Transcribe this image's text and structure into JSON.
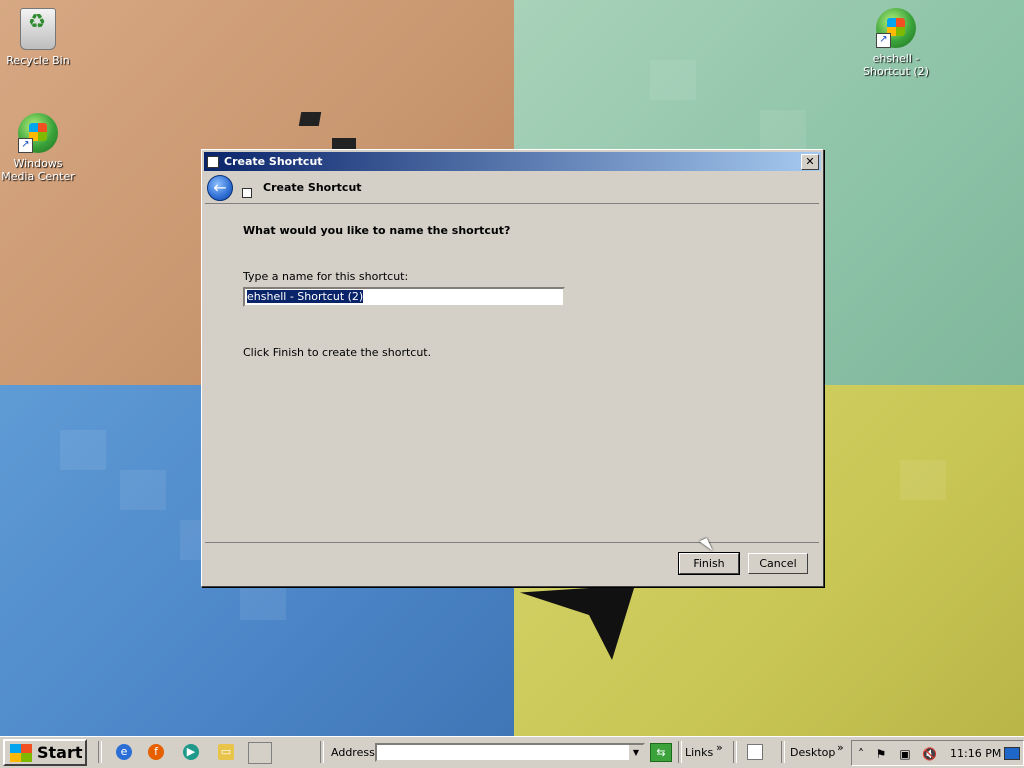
{
  "desktop": {
    "icons": [
      {
        "name": "recycle-bin",
        "label": "Recycle Bin"
      },
      {
        "name": "windows-media-center",
        "label": "Windows Media Center"
      },
      {
        "name": "ehshell-shortcut",
        "label": "ehshell - Shortcut (2)"
      }
    ]
  },
  "dialog": {
    "title": "Create Shortcut",
    "close_glyph": "✕",
    "header_title": "Create Shortcut",
    "back_glyph": "←",
    "question": "What would you like to name the shortcut?",
    "prompt": "Type a name for this shortcut:",
    "name_value": "ehshell - Shortcut (2)",
    "hint": "Click Finish to create the shortcut.",
    "finish_label": "Finish",
    "cancel_label": "Cancel"
  },
  "taskbar": {
    "start_label": "Start",
    "address_label": "Address",
    "address_value": "",
    "go_glyph": "⇆",
    "links_label": "Links",
    "desktop_label": "Desktop",
    "chevron": "»",
    "clock": "11:16 PM"
  },
  "icons": {
    "ie": "e",
    "firefox": "f",
    "media": "▶",
    "folder": "▭",
    "tray_up": "˄",
    "tray_flag": "⚑",
    "tray_network": "▣",
    "tray_volume": "🔇"
  },
  "colors": {
    "titlebar_start": "#0a246a",
    "titlebar_end": "#a6caf0",
    "face": "#d4d0c8",
    "selection": "#0a246a"
  }
}
